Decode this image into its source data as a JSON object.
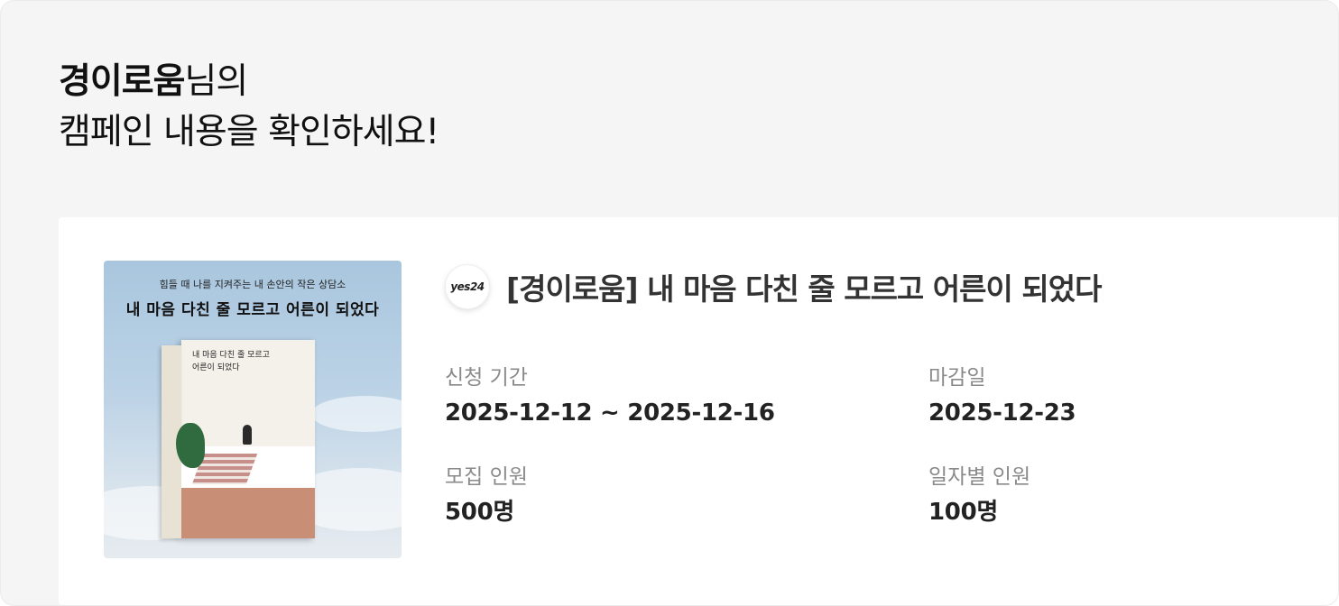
{
  "greeting": {
    "nickname": "경이로움",
    "suffix": "님의",
    "line2": "캠페인 내용을 확인하세요!"
  },
  "campaign": {
    "store_logo": "yes24",
    "title": "[경이로움] 내 마음 다친 줄 모르고 어른이 되었다",
    "cover": {
      "subtitle": "힘들 때 나를 지켜주는 내 손안의 작은 상담소",
      "title": "내 마음 다친 줄 모르고 어른이 되었다",
      "book_title_line1": "내 마음 다친 줄 모르고",
      "book_title_line2": "어른이 되었다"
    },
    "fields": {
      "period": {
        "label": "신청 기간",
        "value": "2025-12-12 ~ 2025-12-16"
      },
      "deadline": {
        "label": "마감일",
        "value": "2025-12-23"
      },
      "recruit": {
        "label": "모집 인원",
        "value": "500명"
      },
      "daily": {
        "label": "일자별 인원",
        "value": "100명"
      }
    }
  }
}
